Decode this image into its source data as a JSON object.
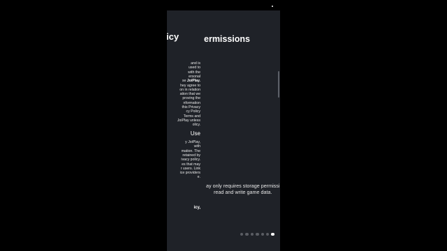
{
  "policy": {
    "title": "icy",
    "lines": [
      {
        "t": "and is",
        "b": ""
      },
      {
        "t": "used to",
        "b": ""
      },
      {
        "t": "with the",
        "b": ""
      },
      {
        "t": "ersonal",
        "b": ""
      },
      {
        "t": "se ",
        "b": "JoiPlay."
      },
      {
        "t": "hey agree to",
        "b": ""
      },
      {
        "t": "on in relation",
        "b": ""
      },
      {
        "t": "ation that we",
        "b": ""
      },
      {
        "t": "proving the",
        "b": ""
      },
      {
        "t": "nformation",
        "b": ""
      },
      {
        "t": "this Privacy",
        "b": ""
      },
      {
        "t": "cy Policy",
        "b": ""
      },
      {
        "t": "Terms and",
        "b": ""
      },
      {
        "t": "JoiPlay unless",
        "b": ""
      },
      {
        "t": "olicy.",
        "b": ""
      }
    ],
    "heading": "Use",
    "lines2": [
      {
        "t": "y JoiPlay,",
        "b": ""
      },
      {
        "t": "with",
        "b": ""
      },
      {
        "t": "mation. The",
        "b": ""
      },
      {
        "t": "retained by",
        "b": ""
      },
      {
        "t": "ivacy policy.",
        "b": ""
      },
      {
        "t": "es that may",
        "b": ""
      },
      {
        "t": "r users. Link",
        "b": ""
      },
      {
        "t": "ice providers",
        "b": ""
      },
      {
        "t": "e.",
        "b": ""
      }
    ],
    "bottom": "icy,"
  },
  "permissions": {
    "title": "ermissions",
    "desc_line1": "ay only requires storage permissi",
    "desc_line2": "read and write game data."
  },
  "pager": {
    "count": 7,
    "active": 6
  },
  "ok_label": "OK"
}
